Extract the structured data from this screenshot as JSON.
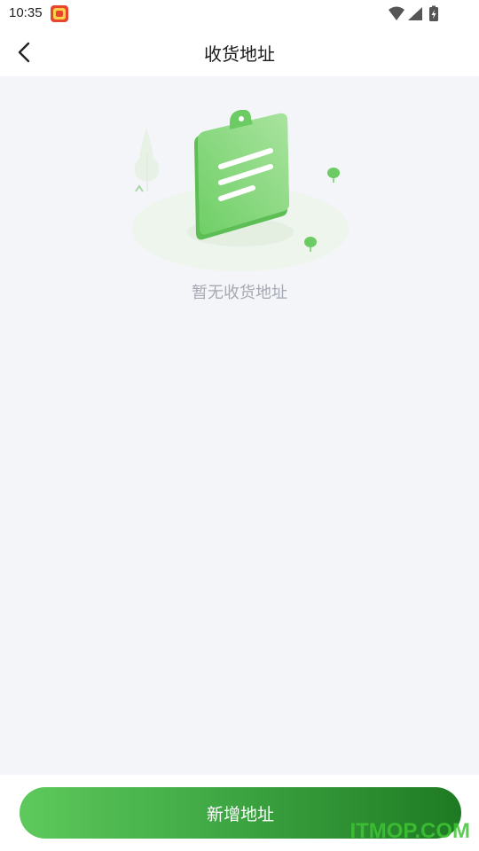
{
  "status_bar": {
    "time": "10:35"
  },
  "nav": {
    "title": "收货地址"
  },
  "empty_state": {
    "message": "暂无收货地址"
  },
  "actions": {
    "add_address_label": "新增地址"
  },
  "watermark": "ITMOP.COM",
  "colors": {
    "brand_green": "#3fa844",
    "page_bg": "#f4f5f9",
    "empty_text": "#a6a9b3"
  },
  "icons": {
    "back": "chevron-left-icon",
    "wifi": "wifi-icon",
    "signal": "signal-icon",
    "battery": "battery-icon",
    "illustration": "empty-clipboard-illustration"
  }
}
